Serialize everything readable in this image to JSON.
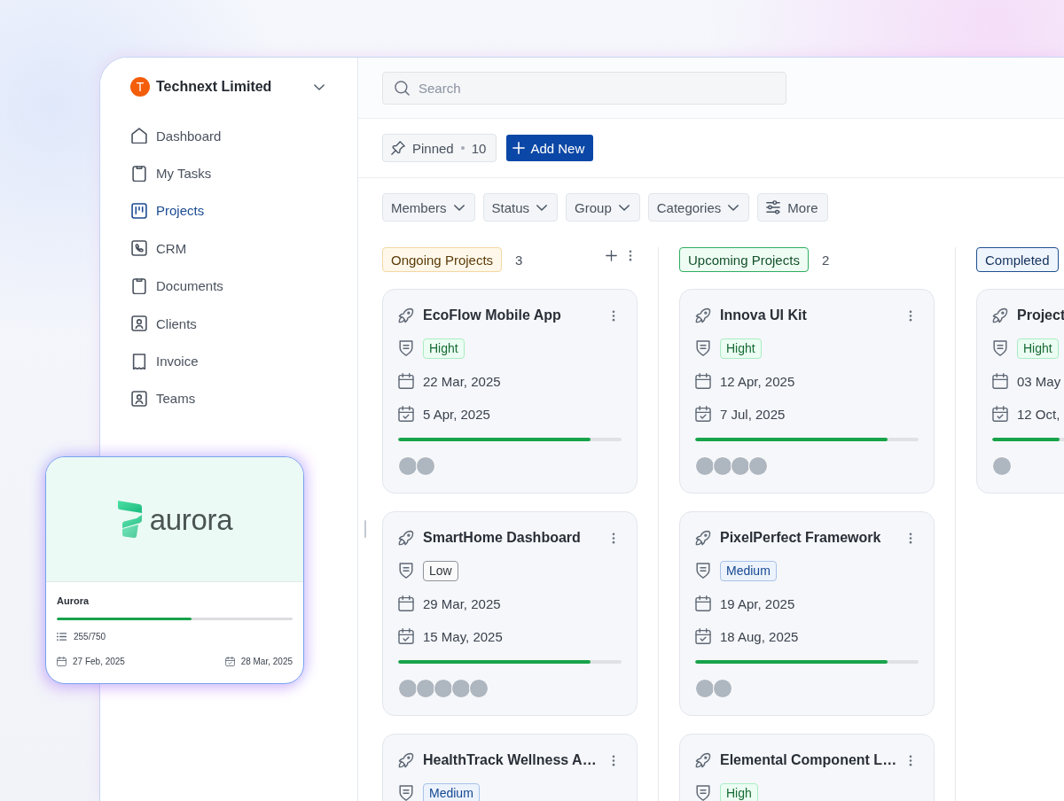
{
  "sidebar": {
    "org": {
      "initial": "T",
      "name": "Technext Limited"
    },
    "items": [
      {
        "label": "Dashboard",
        "selected": false
      },
      {
        "label": "My Tasks",
        "selected": false
      },
      {
        "label": "Projects",
        "selected": true
      },
      {
        "label": "CRM",
        "selected": false
      },
      {
        "label": "Documents",
        "selected": false
      },
      {
        "label": "Clients",
        "selected": false
      },
      {
        "label": "Invoice",
        "selected": false
      },
      {
        "label": "Teams",
        "selected": false
      }
    ]
  },
  "header": {
    "search": {
      "placeholder": "Search"
    }
  },
  "toolbar": {
    "pinned": {
      "label": "Pinned",
      "count": "10"
    },
    "add_button": "Add New"
  },
  "filters": [
    {
      "label": "Members",
      "kind": "dropdown"
    },
    {
      "label": "Status",
      "kind": "dropdown"
    },
    {
      "label": "Group",
      "kind": "dropdown"
    },
    {
      "label": "Categories",
      "kind": "dropdown"
    },
    {
      "label": "More",
      "kind": "options"
    }
  ],
  "columns": [
    {
      "title": "Ongoing Projects",
      "kind": "ongoing",
      "count": "3",
      "hovered": true,
      "cards": [
        {
          "title": "EcoFlow Mobile App",
          "priority": {
            "label": "Hight",
            "kind": "high"
          },
          "start_date": "22 Mar, 2025",
          "end_date": "5 Apr, 2025",
          "level": 0.86,
          "avatars": [
            {
              "kind": "photo"
            },
            {
              "kind": "photo"
            }
          ]
        },
        {
          "title": "SmartHome Dashboard",
          "priority": {
            "label": "Low",
            "kind": "low"
          },
          "start_date": "29 Mar, 2025",
          "end_date": "15 May, 2025",
          "level": 0.86,
          "avatars": [
            {
              "kind": "photo"
            },
            {
              "kind": "photo"
            },
            {
              "kind": "photo"
            },
            {
              "kind": "photo"
            },
            {
              "kind": "photo"
            }
          ]
        },
        {
          "title": "HealthTrack Wellness A…",
          "priority": {
            "label": "Medium",
            "kind": "medium"
          }
        }
      ]
    },
    {
      "title": "Upcoming Projects",
      "kind": "upcoming",
      "count": "2",
      "hovered": false,
      "cards": [
        {
          "title": "Innova UI Kit",
          "priority": {
            "label": "Hight",
            "kind": "high"
          },
          "start_date": "12 Apr, 2025",
          "end_date": "7 Jul, 2025",
          "level": 0.86,
          "avatars": [
            {
              "kind": "photo"
            },
            {
              "kind": "photo"
            },
            {
              "kind": "photo"
            },
            {
              "kind": "photo"
            }
          ]
        },
        {
          "title": "PixelPerfect Framework",
          "priority": {
            "label": "Medium",
            "kind": "medium"
          },
          "start_date": "19 Apr, 2025",
          "end_date": "18 Aug, 2025",
          "level": 0.86,
          "avatars": [
            {
              "kind": "photo"
            },
            {
              "kind": "photo"
            }
          ]
        },
        {
          "title": "Elemental Component L…",
          "priority": {
            "label": "High",
            "kind": "high"
          }
        }
      ]
    },
    {
      "title": "Completed",
      "kind": "completed",
      "hovered": false,
      "cards": [
        {
          "title": "Project",
          "priority": {
            "label": "Hight",
            "kind": "high"
          },
          "start_date": "03 May",
          "end_date": "12 Oct,",
          "level": 0.3,
          "avatars": [
            {
              "kind": "photo"
            }
          ]
        }
      ]
    }
  ],
  "floating_card": {
    "logo_text": "aurora",
    "title": "Aurora",
    "level": 0.57,
    "tasks": "255/750",
    "start_date": "27 Feb, 2025",
    "end_date": "28 Mar, 2025"
  }
}
